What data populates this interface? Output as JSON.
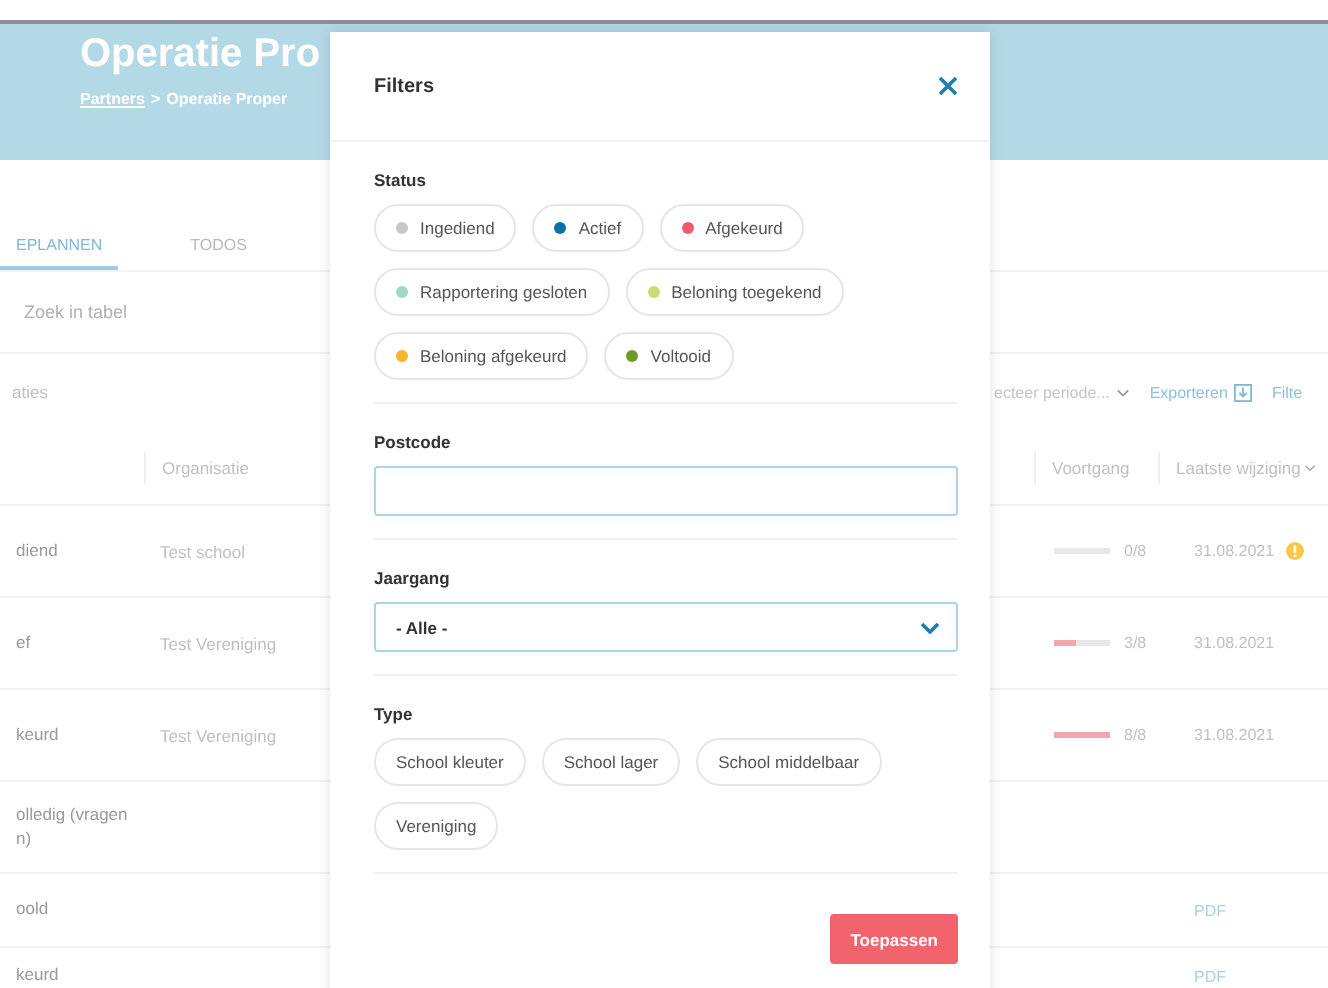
{
  "header": {
    "title": "Operatie Pro",
    "breadcrumb_link": "Partners",
    "breadcrumb_separator": ">",
    "breadcrumb_current": "Operatie Proper"
  },
  "tabs": [
    {
      "label": "EPLANNEN",
      "selected": true
    },
    {
      "label": "TODOS",
      "selected": false
    }
  ],
  "search": {
    "placeholder": "Zoek in tabel"
  },
  "toolbar": {
    "count_label": "aties",
    "period": "ecteer periode...",
    "export": "Exporteren",
    "filter": "Filte"
  },
  "table": {
    "column_2": "Organisatie",
    "column_3": "Voortgang",
    "column_4": "Laatste wijziging",
    "rows": [
      {
        "column_1": "diend",
        "organisation": "Test school",
        "progress": {
          "level": 0,
          "reading": "0/8"
        },
        "date": "31.08.2021",
        "warning": true
      },
      {
        "column_1": "ef",
        "organisation": "Test Vereniging",
        "progress": {
          "level": 0.375,
          "reading": "3/8"
        },
        "date": "31.08.2021",
        "warning": false
      },
      {
        "column_1": "keurd",
        "organisation": "Test Vereniging",
        "progress": {
          "level": 1,
          "reading": "8/8"
        },
        "date": "31.08.2021",
        "warning": false
      },
      {
        "column_1": "olledig (vragen n)",
        "warning": false
      },
      {
        "column_1": "oold",
        "document": "PDF",
        "warning": false
      },
      {
        "column_1": "keurd",
        "document": "PDF",
        "warning": false
      }
    ]
  },
  "filters": {
    "title": "Filters",
    "apply": "Toepassen",
    "sections": [
      {
        "kind": "chips",
        "label": "Status",
        "options": [
          {
            "label": "Ingediend",
            "color": "#c8c8c8",
            "selected": false
          },
          {
            "label": "Actief",
            "color": "#0a73a6",
            "selected": false
          },
          {
            "label": "Afgekeurd",
            "color": "#ec5a6e",
            "selected": false
          },
          {
            "label": "Rapportering gesloten",
            "color": "#9fd9c4",
            "selected": false
          },
          {
            "label": "Beloning toegekend",
            "color": "#c9de72",
            "selected": false
          },
          {
            "label": "Beloning afgekeurd",
            "color": "#f7b52c",
            "selected": false
          },
          {
            "label": "Voltooid",
            "color": "#6f9a2a",
            "selected": false
          }
        ]
      },
      {
        "kind": "input",
        "label": "Postcode"
      },
      {
        "kind": "select",
        "label": "Jaargang",
        "value": "- Alle -"
      },
      {
        "kind": "chips",
        "label": "Type",
        "options": [
          {
            "label": "School kleuter",
            "selected": false
          },
          {
            "label": "School lager",
            "selected": false
          },
          {
            "label": "School middelbaar",
            "selected": false
          },
          {
            "label": "Vereniging",
            "selected": false
          }
        ]
      }
    ]
  }
}
